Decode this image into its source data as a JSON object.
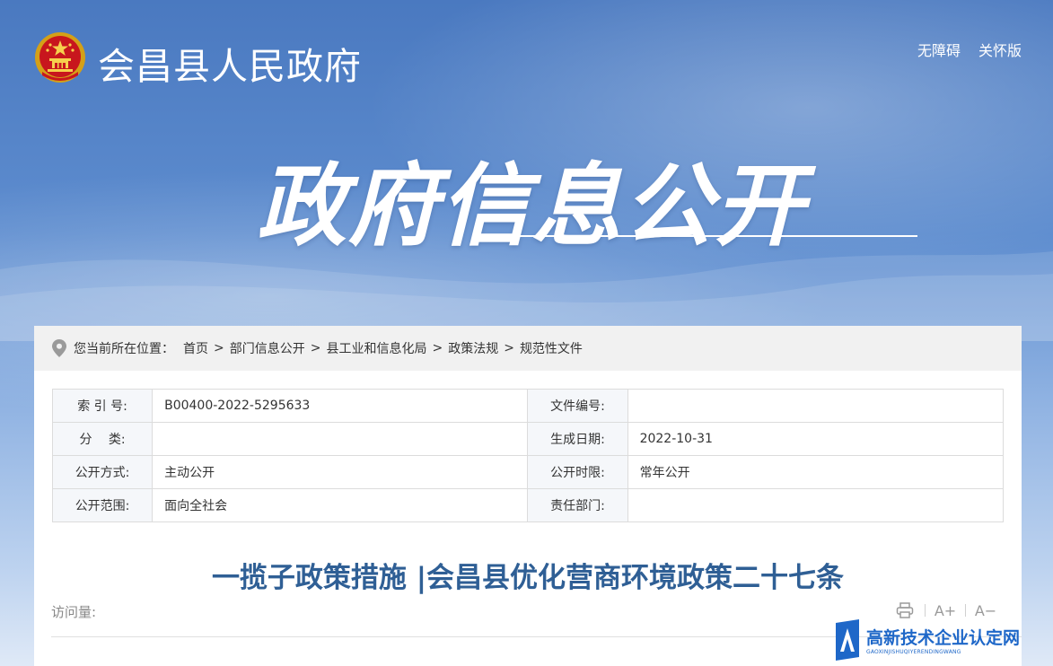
{
  "header": {
    "site_name": "会昌县人民政府",
    "links": [
      "无障碍",
      "关怀版"
    ],
    "hero_title": "政府信息公开"
  },
  "breadcrumb": {
    "prefix": "您当前所在位置：",
    "items": [
      "首页",
      "部门信息公开",
      "县工业和信息化局",
      "政策法规",
      "规范性文件"
    ]
  },
  "meta": {
    "rows": [
      {
        "l1": "索 引 号:",
        "v1": "B00400-2022-5295633",
        "l2": "文件编号:",
        "v2": ""
      },
      {
        "l1": "分　 类:",
        "v1": "",
        "l2": "生成日期:",
        "v2": "2022-10-31"
      },
      {
        "l1": "公开方式:",
        "v1": "主动公开",
        "l2": "公开时限:",
        "v2": "常年公开"
      },
      {
        "l1": "公开范围:",
        "v1": "面向全社会",
        "l2": "责任部门:",
        "v2": ""
      }
    ]
  },
  "article": {
    "title": "一揽子政策措施 |会昌县优化营商环境政策二十七条",
    "visits_label": "访问量:"
  },
  "tools": {
    "font_increase": "A+",
    "font_decrease": "A−"
  },
  "watermark": {
    "cn": "高新技术企业认定网",
    "en": "GAOXINJISHUQIYERENDINGWANG"
  },
  "colors": {
    "title_blue": "#2f5f95",
    "banner_blue": "#4a79c0",
    "watermark_blue": "#1e67c8"
  }
}
